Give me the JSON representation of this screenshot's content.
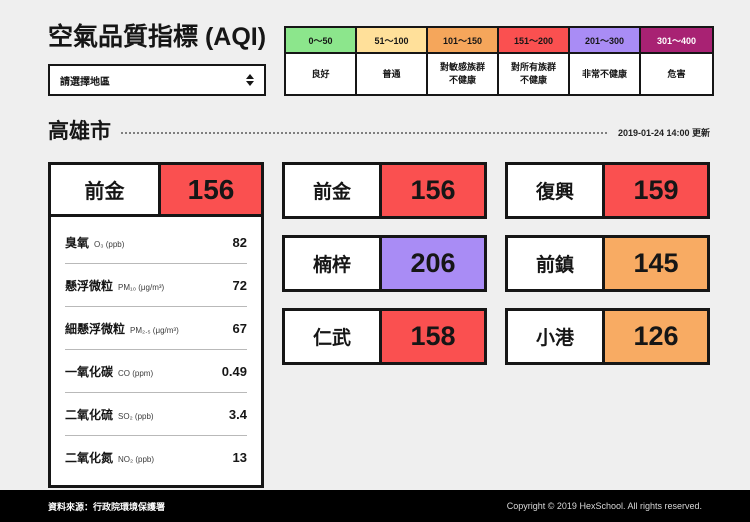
{
  "header": {
    "app_title": "空氣品質指標 (AQI)",
    "region_select": {
      "value": "請選擇地區",
      "icon": "updown-arrows-icon"
    }
  },
  "legend": {
    "columns": [
      {
        "range": "0～50",
        "label": "良好",
        "color": "#8ce68c",
        "text_dark": true
      },
      {
        "range": "51～100",
        "label": "普通",
        "color": "#ffe09a",
        "text_dark": true
      },
      {
        "range": "101～150",
        "label": "對敏感族群\n不健康",
        "color": "#f5a65b",
        "text_dark": true
      },
      {
        "range": "151～200",
        "label": "對所有族群\n不健康",
        "color": "#fa5050",
        "text_dark": true
      },
      {
        "range": "201～300",
        "label": "非常不健康",
        "color": "#a98cf5",
        "text_dark": true
      },
      {
        "range": "301～400",
        "label": "危害",
        "color": "#a82273",
        "text_dark": false
      }
    ]
  },
  "city": {
    "name": "高雄市",
    "updated": "2019-01-24   14:00   更新"
  },
  "detail": {
    "district": "前金",
    "aqi": "156",
    "aqi_color": "#fa5050",
    "pollutants": [
      {
        "name": "臭氧",
        "unit": "O₃ (ppb)",
        "value": "82"
      },
      {
        "name": "懸浮微粒",
        "unit": "PM₁₀ (μg/m³)",
        "value": "72"
      },
      {
        "name": "細懸浮微粒",
        "unit": "PM₂.₅ (μg/m³)",
        "value": "67"
      },
      {
        "name": "一氧化碳",
        "unit": "CO (ppm)",
        "value": "0.49"
      },
      {
        "name": "二氧化硫",
        "unit": "SO₂ (ppb)",
        "value": "3.4"
      },
      {
        "name": "二氧化氮",
        "unit": "NO₂ (ppb)",
        "value": "13"
      }
    ]
  },
  "districts": [
    {
      "name": "前金",
      "aqi": "156",
      "color": "#fa5050"
    },
    {
      "name": "復興",
      "aqi": "159",
      "color": "#fa5050"
    },
    {
      "name": "楠梓",
      "aqi": "206",
      "color": "#a98cf5"
    },
    {
      "name": "前鎮",
      "aqi": "145",
      "color": "#f8ab63"
    },
    {
      "name": "仁武",
      "aqi": "158",
      "color": "#fa5050"
    },
    {
      "name": "小港",
      "aqi": "126",
      "color": "#f8ab63"
    }
  ],
  "footer": {
    "source": "資料來源：行政院環境保護署",
    "copyright": "Copyright © 2019 HexSchool. All rights reserved."
  }
}
